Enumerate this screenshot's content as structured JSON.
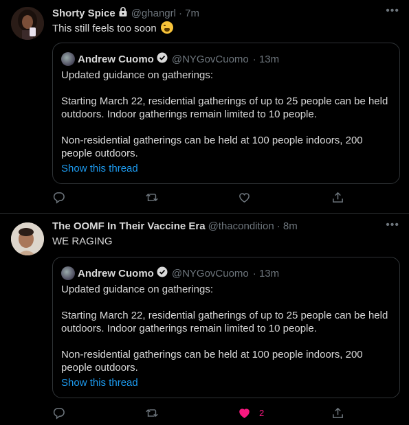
{
  "tweets": [
    {
      "name": "Shorty Spice",
      "handle": "@ghangrl",
      "time": "· 7m",
      "protected": true,
      "text": "This still feels too soon",
      "emoji": "weary-face",
      "quote": {
        "name": "Andrew Cuomo",
        "handle": "@NYGovCuomo",
        "time": "· 13m",
        "para1": "Updated guidance on gatherings:",
        "para2": "Starting March 22, residential gatherings of up to 25 people can be held outdoors. Indoor gatherings remain limited to 10 people.",
        "para3": "Non-residential gatherings can be held at 100 people indoors, 200 people outdoors.",
        "show_thread": "Show this thread"
      },
      "like_count": "",
      "liked": false
    },
    {
      "name": "The OOMF In Their Vaccine Era",
      "handle": "@thacondition",
      "time": "· 8m",
      "protected": false,
      "text": "WE RAGING",
      "quote": {
        "name": "Andrew Cuomo",
        "handle": "@NYGovCuomo",
        "time": "· 13m",
        "para1": "Updated guidance on gatherings:",
        "para2": "Starting March 22, residential gatherings of up to 25 people can be held outdoors. Indoor gatherings remain limited to 10 people.",
        "para3": "Non-residential gatherings can be held at 100 people indoors, 200 people outdoors.",
        "show_thread": "Show this thread"
      },
      "like_count": "2",
      "liked": true
    }
  ],
  "colors": {
    "background": "#000000",
    "text": "#d9d9d9",
    "muted": "#6e767d",
    "link": "#1d9bf0",
    "like": "#f91880",
    "border": "#2f3336"
  },
  "icons": [
    "lock-icon",
    "more-icon",
    "verified-icon",
    "reply-icon",
    "retweet-icon",
    "like-icon",
    "share-icon"
  ]
}
